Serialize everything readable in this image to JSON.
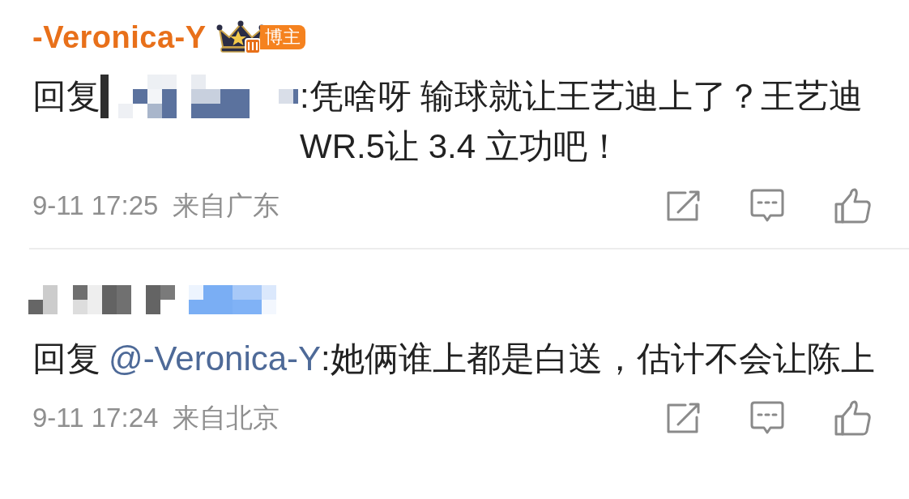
{
  "comments": [
    {
      "author": "-Veronica-Y",
      "author_badge": "博主",
      "reply_prefix": "回复",
      "reply_to_hidden": true,
      "text": ":凭啥呀 输球就让王艺迪上了？王艺迪 WR.5让 3.4 立功吧！",
      "time": "9-11 17:25",
      "location": "来自广东"
    },
    {
      "author_hidden": true,
      "reply_prefix": "回复",
      "reply_to": "@-Veronica-Y",
      "text": ":她俩谁上都是白送，估计不会让陈上",
      "time": "9-11 17:24",
      "location": "来自北京"
    }
  ]
}
